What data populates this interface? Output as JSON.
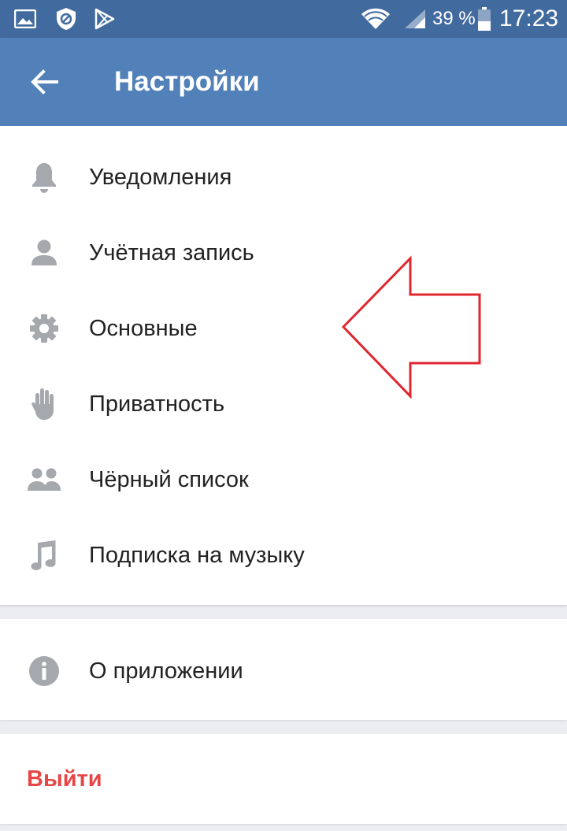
{
  "status_bar": {
    "battery_percent": "39 %",
    "time": "17:23",
    "icons": [
      "image-notification-icon",
      "blocked-icon",
      "play-store-icon",
      "wifi-icon",
      "cellular-signal-icon",
      "battery-icon"
    ]
  },
  "header": {
    "title": "Настройки",
    "back_icon": "arrow-left-icon"
  },
  "menu": {
    "items": [
      {
        "label": "Уведомления",
        "icon": "bell-icon"
      },
      {
        "label": "Учётная запись",
        "icon": "person-icon"
      },
      {
        "label": "Основные",
        "icon": "gear-icon"
      },
      {
        "label": "Приватность",
        "icon": "hand-icon"
      },
      {
        "label": "Чёрный список",
        "icon": "people-icon"
      },
      {
        "label": "Подписка на музыку",
        "icon": "music-note-icon"
      }
    ]
  },
  "about": {
    "label": "О приложении",
    "icon": "info-icon"
  },
  "logout": {
    "label": "Выйти"
  },
  "colors": {
    "status_bar": "#416a9f",
    "app_bar": "#5181b8",
    "icon_gray": "#a5a8ad",
    "logout_red": "#e64646",
    "annotation_arrow": "#e0262f",
    "background": "#ebedf0"
  }
}
